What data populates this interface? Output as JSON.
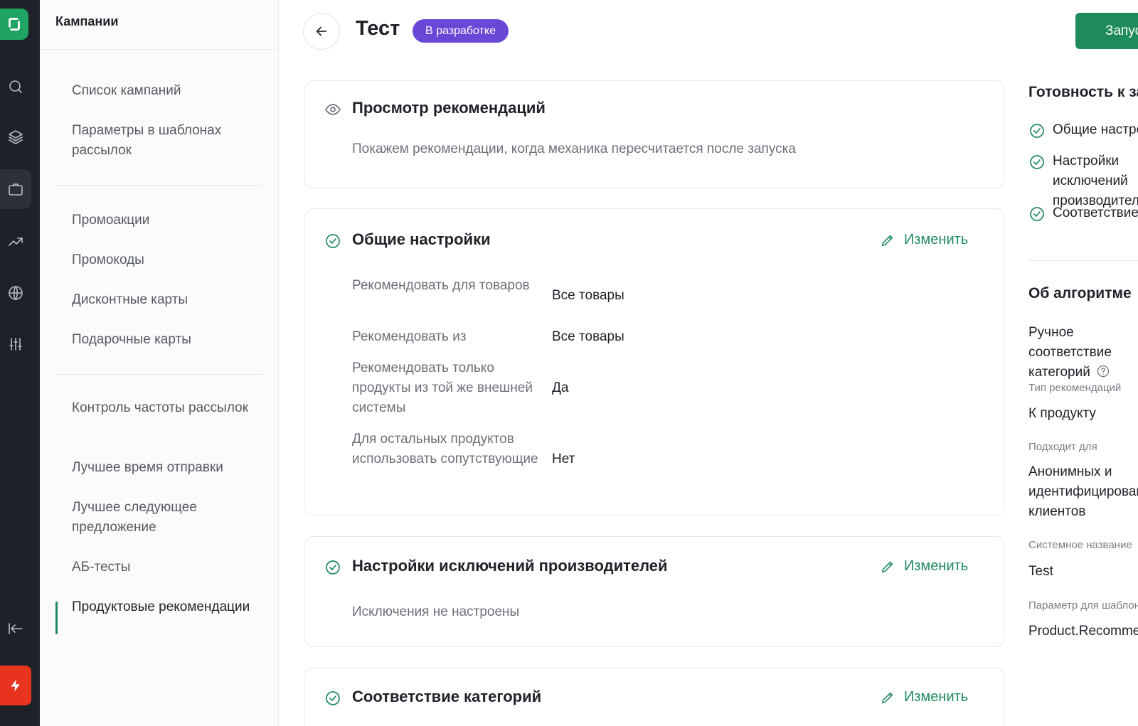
{
  "header": {
    "title": "Тест",
    "status": "В разработке",
    "launch_label": "Запустить"
  },
  "subnav": {
    "title": "Кампании",
    "items": [
      {
        "label": "Список кампаний"
      },
      {
        "label": "Параметры в шаблонах рассылок"
      },
      {
        "label": "Промоакции"
      },
      {
        "label": "Промокоды"
      },
      {
        "label": "Дисконтные карты"
      },
      {
        "label": "Подарочные карты"
      },
      {
        "label": "Контроль частоты рассылок"
      },
      {
        "label": "Лучшее время отправки"
      },
      {
        "label": "Лучшее следующее предложение"
      },
      {
        "label": "АБ-тесты"
      },
      {
        "label": "Продуктовые рекомендации",
        "active": true
      }
    ]
  },
  "cards": {
    "preview": {
      "title": "Просмотр рекомендаций",
      "text": "Покажем рекомендации, когда механика пересчитается после запуска"
    },
    "general": {
      "title": "Общие настройки",
      "edit_label": "Изменить",
      "rows": [
        {
          "label": "Рекомендовать для товаров",
          "value": "Все товары"
        },
        {
          "label": "Рекомендовать из",
          "value": "Все товары"
        },
        {
          "label": "Рекомендовать только продукты из той же внешней системы",
          "value": "Да"
        },
        {
          "label": "Для остальных продуктов использовать сопутствующие",
          "value": "Нет"
        }
      ]
    },
    "exclusions": {
      "title": "Настройки исключений производителей",
      "edit_label": "Изменить",
      "text": "Исключения не настроены"
    },
    "categories": {
      "title": "Соответствие категорий",
      "edit_label": "Изменить"
    }
  },
  "right_panel": {
    "readiness_title": "Готовность к запуску",
    "checks": [
      {
        "label": "Общие настройки"
      },
      {
        "label": "Настройки исключений производителей"
      },
      {
        "label": "Соответствие категорий"
      }
    ],
    "algo_title": "Об алгоритме",
    "algo_name": "Ручное соответствие категорий",
    "fields": [
      {
        "label": "Тип рекомендаций",
        "value": "К продукту"
      },
      {
        "label": "Подходит для",
        "value": "Анонимных и идентифицированных клиентов"
      },
      {
        "label": "Системное название",
        "value": "Test"
      },
      {
        "label": "Параметр для шаблона",
        "value": "Product.Recommendations"
      }
    ]
  },
  "colors": {
    "accent": "#1f8a5c",
    "badge": "#6a48d7",
    "rail": "#1e2228",
    "danger": "#e8331f"
  }
}
